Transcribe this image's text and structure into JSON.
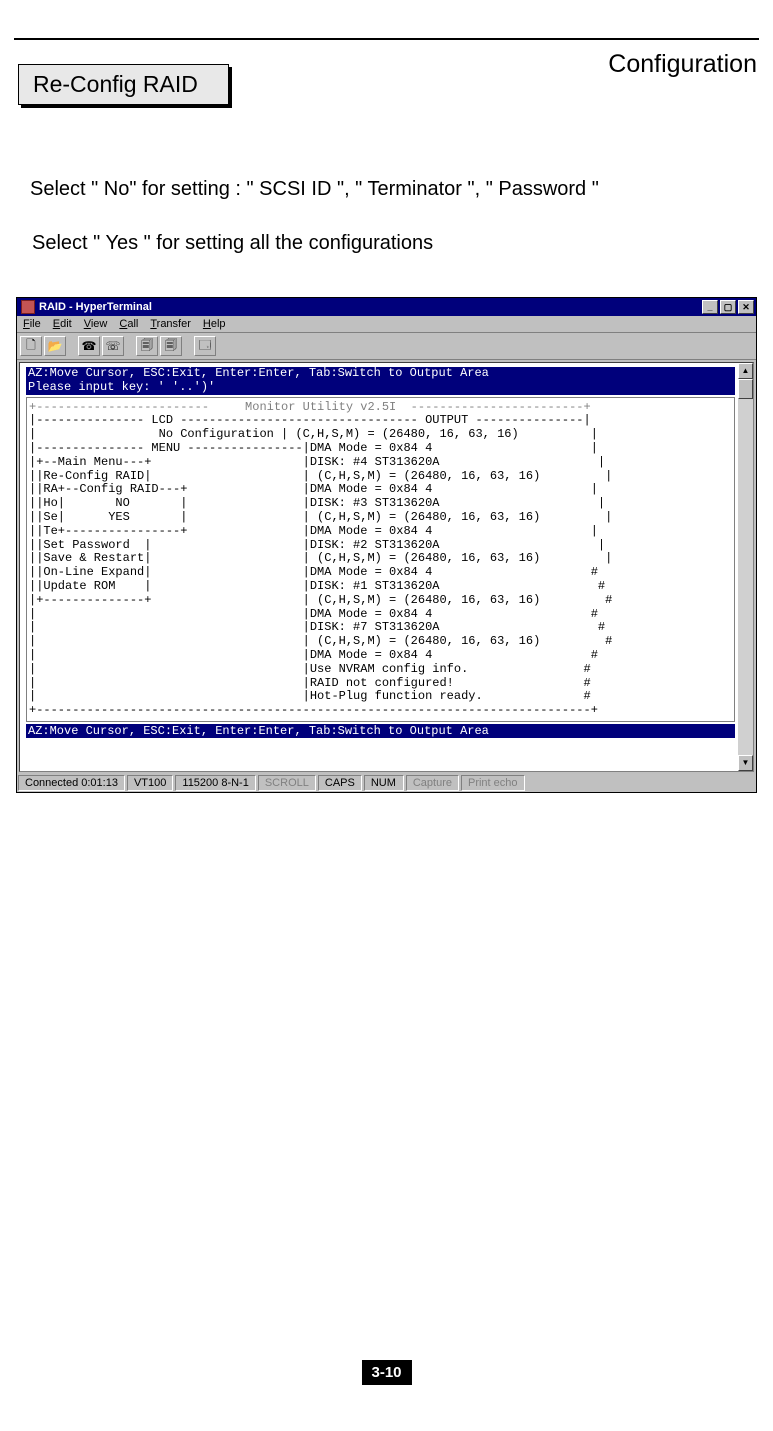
{
  "page": {
    "header": "Configuration",
    "section_heading": "Re-Config RAID",
    "body_line1": "Select \" No\" for setting :  \" SCSI ID \", \" Terminator \", \" Password \"",
    "body_line2": "Select \" Yes \" for setting all the configurations",
    "page_number": "3-10"
  },
  "window": {
    "title": "RAID - HyperTerminal",
    "sys_min": "_",
    "sys_max": "▢",
    "sys_close": "✕",
    "menu": {
      "file": "File",
      "edit": "Edit",
      "view": "View",
      "call": "Call",
      "transfer": "Transfer",
      "help": "Help"
    },
    "toolbar_icons": [
      "new-doc-icon",
      "open-doc-icon",
      "connect-icon",
      "disconnect-icon",
      "send-icon",
      "receive-icon",
      "properties-icon"
    ],
    "status": {
      "connected": "Connected 0:01:13",
      "emulation": "VT100",
      "port": "115200 8-N-1",
      "scroll": "SCROLL",
      "caps": "CAPS",
      "num": "NUM",
      "capture": "Capture",
      "printecho": "Print echo"
    }
  },
  "terminal": {
    "top_highlight": "AZ:Move Cursor, ESC:Exit, Enter:Enter, Tab:Switch to Output Area\nPlease input key: ' '..')'",
    "monitor_title_line": "+------------------------     Monitor Utility v2.5I  ------------------------+",
    "body": "|--------------- LCD --------------------------------- OUTPUT ---------------|\n|                 No Configuration | (C,H,S,M) = (26480, 16, 63, 16)          |\n|--------------- MENU ----------------|DMA Mode = 0x84 4                      |\n|+--Main Menu---+                     |DISK: #4 ST313620A                      |\n||Re-Config RAID|                     | (C,H,S,M) = (26480, 16, 63, 16)         |\n||RA+--Config RAID---+                |DMA Mode = 0x84 4                      |\n||Ho|       NO       |                |DISK: #3 ST313620A                      |\n||Se|      YES       |                | (C,H,S,M) = (26480, 16, 63, 16)         |\n||Te+----------------+                |DMA Mode = 0x84 4                      |\n||Set Password  |                     |DISK: #2 ST313620A                      |\n||Save & Restart|                     | (C,H,S,M) = (26480, 16, 63, 16)         |\n||On-Line Expand|                     |DMA Mode = 0x84 4                      #\n||Update ROM    |                     |DISK: #1 ST313620A                      #\n|+--------------+                     | (C,H,S,M) = (26480, 16, 63, 16)         #\n|                                     |DMA Mode = 0x84 4                      #\n|                                     |DISK: #7 ST313620A                      #\n|                                     | (C,H,S,M) = (26480, 16, 63, 16)         #\n|                                     |DMA Mode = 0x84 4                      #\n|                                     |Use NVRAM config info.                #\n|                                     |RAID not configured!                  #\n|                                     |Hot-Plug function ready.              #\n+-----------------------------------------------------------------------------+",
    "bottom_highlight": "AZ:Move Cursor, ESC:Exit, Enter:Enter, Tab:Switch to Output Area",
    "menu_items": [
      "Re-Config RAID",
      "RA",
      "Ho",
      "Se",
      "Te",
      "Set Password",
      "Save & Restart",
      "On-Line Expand",
      "Update ROM"
    ],
    "config_raid_options": [
      "NO",
      "YES"
    ],
    "disks": [
      {
        "id": "#4",
        "model": "ST313620A",
        "chsm": "(26480, 16, 63, 16)",
        "dma": "0x84 4"
      },
      {
        "id": "#3",
        "model": "ST313620A",
        "chsm": "(26480, 16, 63, 16)",
        "dma": "0x84 4"
      },
      {
        "id": "#2",
        "model": "ST313620A",
        "chsm": "(26480, 16, 63, 16)",
        "dma": "0x84 4"
      },
      {
        "id": "#1",
        "model": "ST313620A",
        "chsm": "(26480, 16, 63, 16)",
        "dma": "0x84 4"
      },
      {
        "id": "#7",
        "model": "ST313620A",
        "chsm": "(26480, 16, 63, 16)",
        "dma": "0x84 4"
      }
    ],
    "messages": [
      "Use NVRAM config info.",
      "RAID not configured!",
      "Hot-Plug function ready."
    ],
    "lcd_message": "No Configuration",
    "utility_version": "Monitor Utility v2.5I"
  }
}
